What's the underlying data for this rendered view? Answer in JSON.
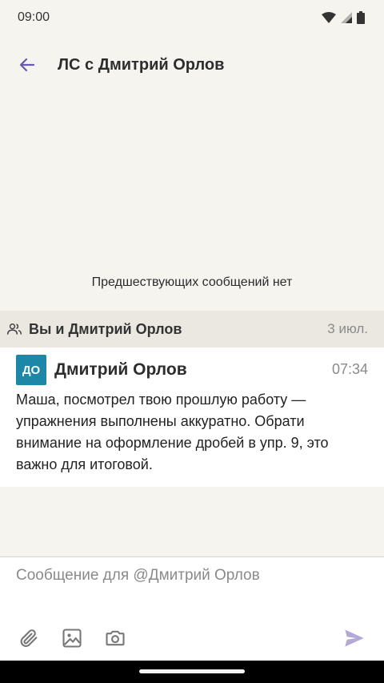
{
  "status": {
    "time": "09:00"
  },
  "header": {
    "title": "ЛС с Дмитрий Орлов"
  },
  "empty_state": {
    "text": "Предшествующих сообщений нет"
  },
  "conversation": {
    "title": "Вы и Дмитрий Орлов",
    "date": "3 июл."
  },
  "message": {
    "avatar_initials": "ДО",
    "sender": "Дмитрий Орлов",
    "time": "07:34",
    "text": "Маша, посмотрел твою прошлую работу — упражнения выполнены аккуратно. Обрати внимание на оформление дробей в упр. 9, это важно для итоговой."
  },
  "composer": {
    "placeholder": "Сообщение для @Дмитрий Орлов"
  },
  "icons": {
    "back": "arrow-left-icon",
    "people": "people-icon",
    "attach": "paperclip-icon",
    "image": "image-icon",
    "camera": "camera-icon",
    "send": "send-icon"
  },
  "colors": {
    "accent": "#6b57b0",
    "avatar": "#1d87a8",
    "send_disabled": "#b3a8d6"
  }
}
